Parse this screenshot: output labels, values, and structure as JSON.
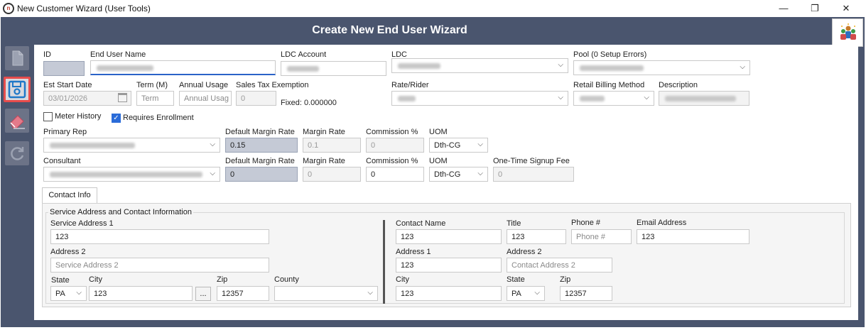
{
  "window": {
    "title": "New Customer Wizard (User Tools)",
    "minimize": "—",
    "maximize": "❐",
    "close": "✕"
  },
  "header": {
    "title": "Create New End User Wizard"
  },
  "labels": {
    "id": "ID",
    "end_user_name": "End User Name",
    "ldc_account": "LDC Account",
    "ldc": "LDC",
    "pool": "Pool (0 Setup Errors)",
    "est_start_date": "Est Start Date",
    "term": "Term (M)",
    "annual_usage": "Annual Usage",
    "sales_tax_exemption": "Sales Tax Exemption",
    "rate_rider": "Rate/Rider",
    "retail_billing_method": "Retail Billing Method",
    "description": "Description",
    "meter_history": "Meter History",
    "requires_enrollment": "Requires Enrollment",
    "primary_rep": "Primary Rep",
    "default_margin_rate": "Default Margin Rate",
    "margin_rate": "Margin Rate",
    "commission": "Commission %",
    "uom": "UOM",
    "consultant": "Consultant",
    "one_time_signup_fee": "One-Time Signup Fee"
  },
  "values": {
    "est_start_date": "03/01/2026",
    "term_placeholder": "Term",
    "annual_usage_placeholder": "Annual Usag",
    "sales_tax_value": "0",
    "fixed_text": "Fixed: 0.000000",
    "primary_default_margin": "0.15",
    "primary_margin_rate": "0.1",
    "primary_commission": "0",
    "primary_uom": "Dth-CG",
    "consultant_default_margin": "0",
    "consultant_margin_rate": "0",
    "consultant_commission": "0",
    "consultant_uom": "Dth-CG",
    "signup_fee": "0"
  },
  "checkboxes": {
    "meter_history": false,
    "requires_enrollment": true
  },
  "tabs": [
    "Contact Info"
  ],
  "contact": {
    "group_title": "Service Address and Contact Information",
    "service_address_1_label": "Service Address 1",
    "service_address_1": "123",
    "address_2_label": "Address 2",
    "service_address_2_placeholder": "Service Address 2",
    "state_label": "State",
    "state": "PA",
    "city_label": "City",
    "city": "123",
    "ellipsis": "...",
    "zip_label": "Zip",
    "zip": "12357",
    "county_label": "County",
    "contact_name_label": "Contact Name",
    "contact_name": "123",
    "title_label": "Title",
    "title": "123",
    "phone_label": "Phone #",
    "phone_placeholder": "Phone #",
    "email_label": "Email Address",
    "email": "123",
    "contact_address_1_label": "Address 1",
    "contact_address_1": "123",
    "contact_address_2_label": "Address 2",
    "contact_address_2_placeholder": "Contact Address 2",
    "contact_city_label": "City",
    "contact_city": "123",
    "contact_state_label": "State",
    "contact_state": "PA",
    "contact_zip_label": "Zip",
    "contact_zip": "12357"
  },
  "icons": {
    "app": "app-logo-icon",
    "new": "new-document-icon",
    "save": "save-icon",
    "clear": "eraser-icon",
    "refresh": "refresh-icon",
    "users": "users-group-icon",
    "calendar": "calendar-icon",
    "dropdown": "chevron-down-icon"
  },
  "colors": {
    "frame": "#4a556e",
    "accent": "#2a63c8",
    "highlight": "#e74c4c",
    "shaded_field": "#c5cad6"
  }
}
